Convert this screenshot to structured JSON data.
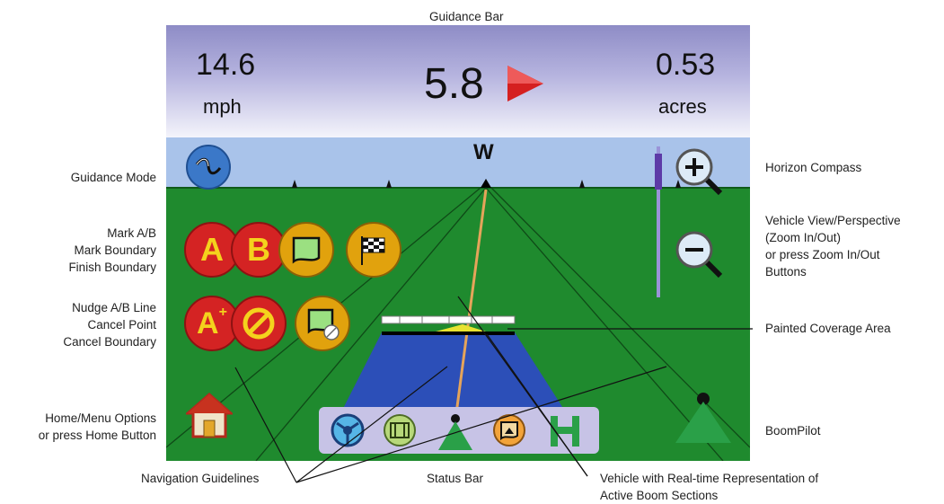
{
  "callouts": {
    "guidance_bar": "Guidance Bar",
    "guidance_mode": "Guidance Mode",
    "mark_group": [
      "Mark A/B",
      "Mark Boundary",
      "Finish Boundary"
    ],
    "nudge_group": [
      "Nudge A/B Line",
      "Cancel Point",
      "Cancel Boundary"
    ],
    "home": [
      "Home/Menu Options",
      "or press Home Button"
    ],
    "horizon_compass": "Horizon Compass",
    "vehicle_view": [
      "Vehicle View/Perspective",
      "(Zoom In/Out)",
      "or press Zoom In/Out",
      "Buttons"
    ],
    "painted_coverage": "Painted Coverage Area",
    "boompilot": "BoomPilot",
    "navigation_guidelines": "Navigation Guidelines",
    "status_bar": "Status Bar",
    "vehicle": [
      "Vehicle with Real-time Representation of",
      "Active Boom Sections"
    ]
  },
  "guidance": {
    "speed_value": "14.6",
    "speed_unit": "mph",
    "offset_value": "5.8",
    "area_value": "0.53",
    "area_unit": "acres"
  },
  "compass": {
    "heading": "W"
  },
  "buttons": {
    "mark_a": "A",
    "mark_b": "B",
    "nudge": "A",
    "nudge_sup": "+"
  },
  "colors": {
    "sky": "#a9c3ea",
    "field": "#1f8a2e",
    "coverage": "#2c4fb8",
    "guide_line": "#e5a45a",
    "red_button": "#d42323",
    "gold_button": "#e1a20d",
    "mode_button": "#3b78c8",
    "arrow": "#d52020"
  }
}
